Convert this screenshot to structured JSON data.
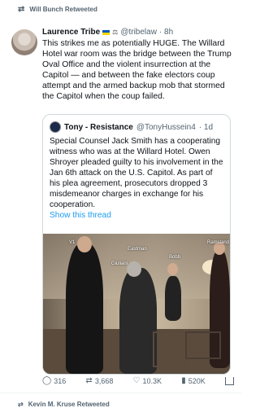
{
  "retweet": {
    "label": "Will Bunch Retweeted"
  },
  "tweet": {
    "author": "Laurence Tribe",
    "handle": "@tribelaw",
    "time": "· 8h",
    "text": "This strikes me as potentially HUGE. The Willard Hotel war room was the bridge between the Trump Oval Office and the violent insurrection at the Capitol — and between the fake electors coup attempt and the armed backup mob that stormed the Capitol when the coup failed."
  },
  "quote": {
    "author": "Tony - Resistance",
    "handle": "@TonyHussein4",
    "time": "· 1d",
    "text": "Special Counsel Jack Smith has a cooperating witness who was at the Willard Hotel. Owen Shroyer pleaded guilty to his involvement in the Jan 6th attack on the U.S. Capitol. As part of his plea agreement, prosecutors dropped 3 misdemeanor charges in exchange for his cooperation.",
    "show_thread": "Show this thread",
    "photo_labels": [
      "V1",
      "Eastman",
      "Giuliani",
      "Bobb",
      "Ramsland"
    ]
  },
  "actions": {
    "replies": "316",
    "retweets": "3,668",
    "likes": "10.3K",
    "views": "520K"
  },
  "next_retweet": {
    "label": "Kevin M. Kruse Retweeted"
  },
  "icons": {
    "retweet": "retweet-icon",
    "reply": "reply-icon",
    "like": "heart-icon",
    "views": "views-icon",
    "share": "share-icon"
  }
}
